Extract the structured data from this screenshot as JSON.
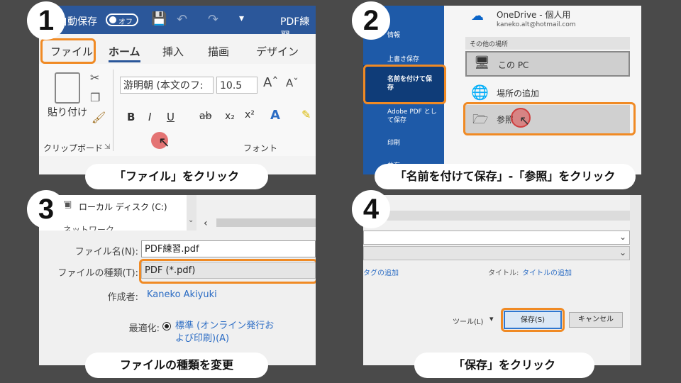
{
  "step1": {
    "number": "1",
    "autosave_label": "自動保存",
    "toggle_text": "オフ",
    "doc_title": "PDF練習",
    "tabs": [
      "ファイル",
      "ホーム",
      "挿入",
      "描画",
      "デザイン"
    ],
    "paste_label": "貼り付け",
    "font_name": "游明朝 (本文のフ:",
    "font_size": "10.5",
    "clipboard_group": "クリップボード",
    "font_group": "フォント",
    "caption": "「ファイル」をクリック"
  },
  "step2": {
    "number": "2",
    "sidebar": [
      "情報",
      "上書き保存",
      "名前を付けて保存",
      "Adobe PDF として保存",
      "印刷",
      "共有"
    ],
    "onedrive_name": "OneDrive - 個人用",
    "onedrive_email": "kaneko.alt@hotmail.com",
    "other_places": "その他の場所",
    "this_pc": "この PC",
    "add_place": "場所の追加",
    "browse": "参照",
    "caption": "「名前を付けて保存」-「参照」をクリック"
  },
  "step3": {
    "number": "3",
    "local_disk": "ローカル ディスク (C:)",
    "network": "ネットワーク",
    "filename_label": "ファイル名(N):",
    "filename_value": "PDF練習.pdf",
    "filetype_label": "ファイルの種類(T):",
    "filetype_value": "PDF (*.pdf)",
    "author_label": "作成者:",
    "author_value": "Kaneko Akiyuki",
    "optimize_label": "最適化:",
    "optimize_value": "標準 (オンライン発行および印刷)(A)",
    "caption": "ファイルの種類を変更"
  },
  "step4": {
    "number": "4",
    "tags_link": "タグの追加",
    "title_label": "タイトル:",
    "title_link": "タイトルの追加",
    "tools_label": "ツール(L)",
    "save_button": "保存(S)",
    "cancel_button": "キャンセル",
    "caption": "「保存」をクリック"
  },
  "colors": {
    "highlight": "#f08a24",
    "word_blue": "#2b579a",
    "backstage_blue": "#1e5aa8"
  }
}
